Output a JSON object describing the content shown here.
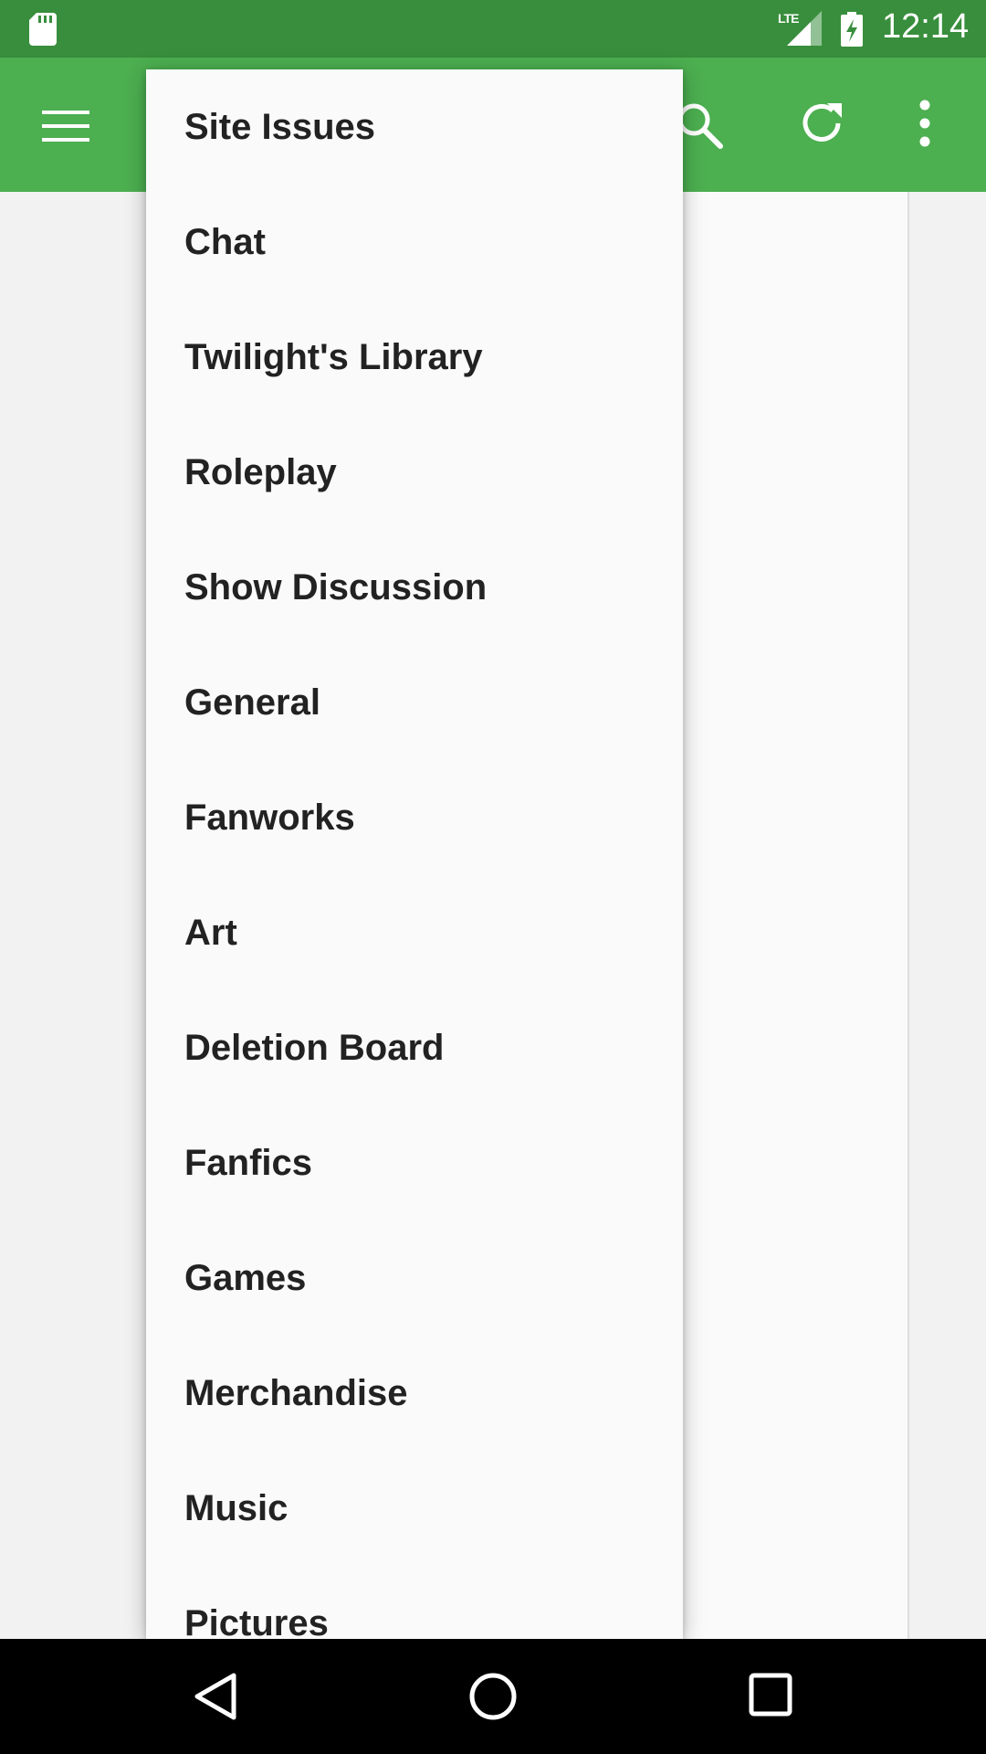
{
  "status_bar": {
    "network_label": "LTE",
    "time": "12:14",
    "icons": [
      "sd-card-icon",
      "lte-signal-icon",
      "battery-charging-icon"
    ]
  },
  "toolbar": {
    "icons": [
      "menu-icon",
      "search-icon",
      "refresh-icon",
      "more-vert-icon"
    ],
    "color": "#4caf50"
  },
  "dropdown": {
    "items": [
      "Site Issues",
      "Chat",
      "Twilight's Library",
      "Roleplay",
      "Show Discussion",
      "General",
      "Fanworks",
      "Art",
      "Deletion Board",
      "Fanfics",
      "Games",
      "Merchandise",
      "Music",
      "Pictures"
    ]
  },
  "nav_bar": {
    "icons": [
      "back-icon",
      "home-icon",
      "recents-icon"
    ]
  },
  "colors": {
    "status_bar": "#388e3c",
    "toolbar": "#4caf50",
    "text": "#222222"
  }
}
